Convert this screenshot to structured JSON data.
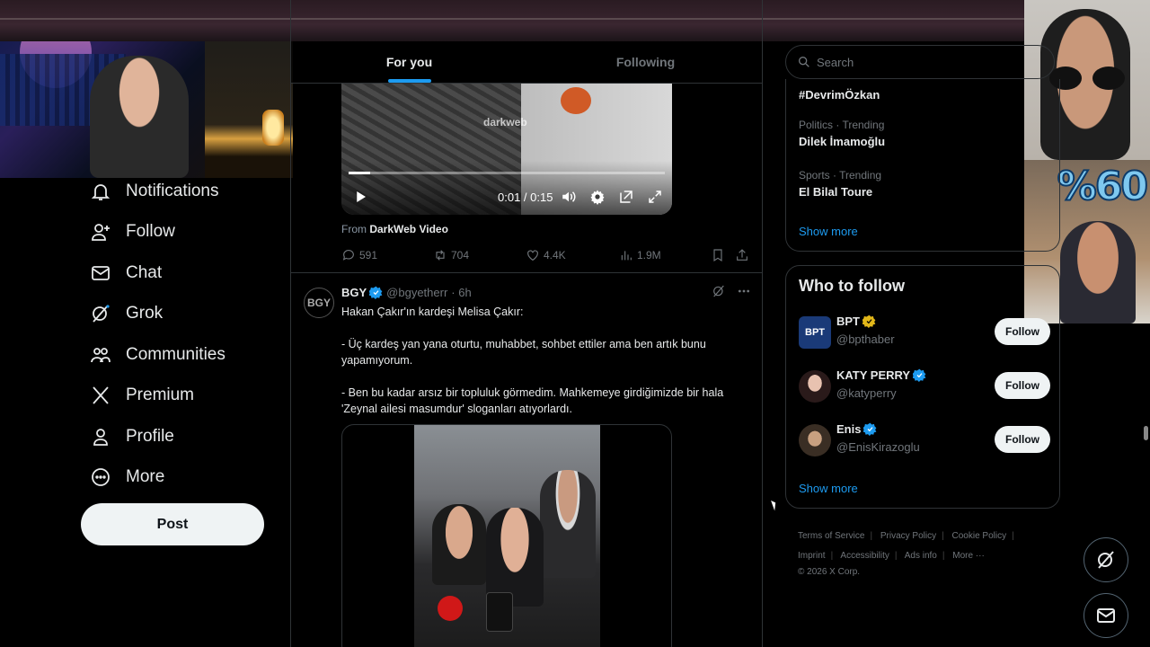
{
  "nav": {
    "items": [
      {
        "label": "Notifications",
        "icon": "bell-icon"
      },
      {
        "label": "Follow",
        "icon": "person-add-icon"
      },
      {
        "label": "Chat",
        "icon": "envelope-icon"
      },
      {
        "label": "Grok",
        "icon": "grok-icon"
      },
      {
        "label": "Communities",
        "icon": "people-icon"
      },
      {
        "label": "Premium",
        "icon": "x-logo-icon"
      },
      {
        "label": "Profile",
        "icon": "person-icon"
      },
      {
        "label": "More",
        "icon": "more-circle-icon"
      }
    ],
    "post_label": "Post"
  },
  "tabs": [
    {
      "label": "For you",
      "active": true
    },
    {
      "label": "Following",
      "active": false
    }
  ],
  "tweet1": {
    "video": {
      "watermark": "darkweb",
      "time": "0:01 / 0:15",
      "progress_fraction": 0.067
    },
    "from_prefix": "From",
    "from_source": "DarkWeb Video",
    "stats": {
      "replies": "591",
      "reposts": "704",
      "likes": "4.4K",
      "views": "1.9M"
    }
  },
  "tweet2": {
    "avatar_text": "BGY",
    "name": "BGY",
    "handle": "@bgyetherr",
    "time": "· 6h",
    "text": "Hakan Çakır'ın kardeşi Melisa Çakır:\n\n- Üç kardeş yan yana oturtu, muhabbet, sohbet ettiler ama ben artık bunu yapamıyorum.\n\n- Ben bu kadar arsız bir topluluk görmedim. Mahkemeye girdiğimizde bir hala 'Zeynal ailesi masumdur' sloganları atıyorlardı."
  },
  "search": {
    "placeholder": "Search"
  },
  "trends": [
    {
      "context": "",
      "name": "#DevrimÖzkan"
    },
    {
      "context": "Politics · Trending",
      "name": "Dilek İmamoğlu"
    },
    {
      "context": "Sports · Trending",
      "name": "El Bilal Toure"
    }
  ],
  "trends_show_more": "Show more",
  "who_to_follow": {
    "title": "Who to follow",
    "accounts": [
      {
        "name": "BPT",
        "handle": "@bpthaber",
        "badge": "gold",
        "avatar_text": "BPT",
        "follow_label": "Follow"
      },
      {
        "name": "KATY PERRY",
        "handle": "@katyperry",
        "badge": "blue",
        "avatar_text": "",
        "follow_label": "Follow"
      },
      {
        "name": "Enis",
        "handle": "@EnisKirazoglu",
        "badge": "blue",
        "avatar_text": "",
        "follow_label": "Follow"
      }
    ],
    "show_more": "Show more"
  },
  "footer": {
    "links_row1": [
      "Terms of Service",
      "Privacy Policy",
      "Cookie Policy"
    ],
    "links_row2": [
      "Imprint",
      "Accessibility",
      "Ads info",
      "More ···"
    ],
    "copyright": "© 2026 X Corp."
  },
  "overlay": {
    "poll_text": "%60"
  },
  "colors": {
    "accent": "#1d9bf0",
    "background": "#000000",
    "border": "#2f3336",
    "muted": "#71767b",
    "verified_gold": "#e2b719"
  }
}
